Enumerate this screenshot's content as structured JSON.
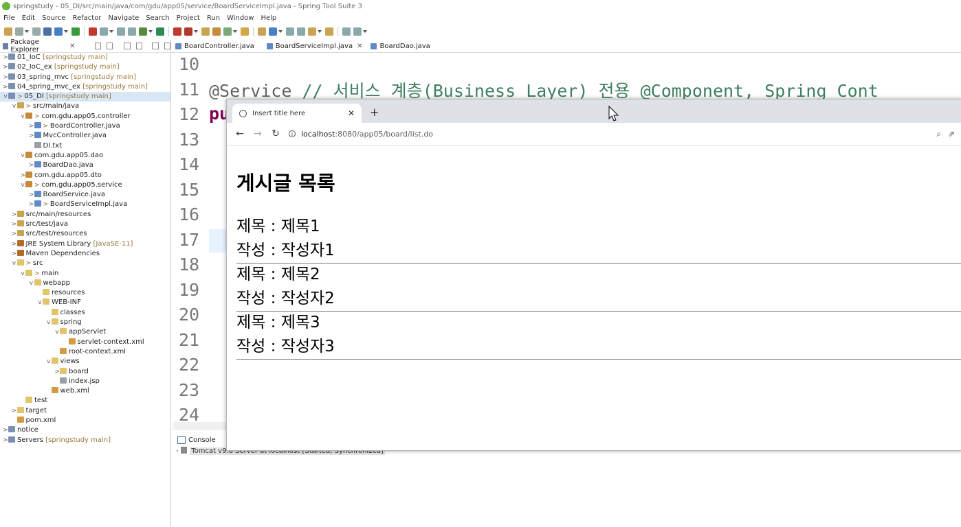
{
  "window": {
    "title": "springstudy - 05_DI/src/main/java/com/gdu/app05/service/BoardServiceImpl.java - Spring Tool Suite 3"
  },
  "menu": [
    "File",
    "Edit",
    "Source",
    "Refactor",
    "Navigate",
    "Search",
    "Project",
    "Run",
    "Window",
    "Help"
  ],
  "package_explorer": {
    "title": "Package Explorer",
    "items": [
      {
        "indent": 0,
        "twisty": ">",
        "icon": "project",
        "prefix": "",
        "label": "01_IoC",
        "suffix": " [springstudy main]"
      },
      {
        "indent": 0,
        "twisty": ">",
        "icon": "project",
        "prefix": "",
        "label": "02_IoC_ex",
        "suffix": " [springstudy main]"
      },
      {
        "indent": 0,
        "twisty": ">",
        "icon": "project",
        "prefix": "",
        "label": "03_spring_mvc",
        "suffix": " [springstudy main]"
      },
      {
        "indent": 0,
        "twisty": ">",
        "icon": "project",
        "prefix": "",
        "label": "04_spring_mvc_ex",
        "suffix": " [springstudy main]"
      },
      {
        "indent": 0,
        "twisty": "v",
        "icon": "project",
        "prefix": "> ",
        "label": "05_DI",
        "suffix": " [springstudy main]",
        "selected": true
      },
      {
        "indent": 1,
        "twisty": "v",
        "icon": "src",
        "prefix": "> ",
        "label": "src/main/java",
        "suffix": ""
      },
      {
        "indent": 2,
        "twisty": "v",
        "icon": "pkg",
        "prefix": "> ",
        "label": "com.gdu.app05.controller",
        "suffix": ""
      },
      {
        "indent": 3,
        "twisty": ">",
        "icon": "java",
        "prefix": "> ",
        "label": "BoardController.java",
        "suffix": ""
      },
      {
        "indent": 3,
        "twisty": ">",
        "icon": "java",
        "prefix": "",
        "label": "MvcController.java",
        "suffix": ""
      },
      {
        "indent": 3,
        "twisty": "",
        "icon": "txt",
        "prefix": "",
        "label": "DI.txt",
        "suffix": ""
      },
      {
        "indent": 2,
        "twisty": "v",
        "icon": "pkg",
        "prefix": "",
        "label": "com.gdu.app05.dao",
        "suffix": ""
      },
      {
        "indent": 3,
        "twisty": ">",
        "icon": "java",
        "prefix": "",
        "label": "BoardDao.java",
        "suffix": ""
      },
      {
        "indent": 2,
        "twisty": ">",
        "icon": "pkg",
        "prefix": "",
        "label": "com.gdu.app05.dto",
        "suffix": ""
      },
      {
        "indent": 2,
        "twisty": "v",
        "icon": "pkg",
        "prefix": "> ",
        "label": "com.gdu.app05.service",
        "suffix": ""
      },
      {
        "indent": 3,
        "twisty": ">",
        "icon": "java",
        "prefix": "",
        "label": "BoardService.java",
        "suffix": ""
      },
      {
        "indent": 3,
        "twisty": ">",
        "icon": "java",
        "prefix": "> ",
        "label": "BoardServiceImpl.java",
        "suffix": ""
      },
      {
        "indent": 1,
        "twisty": ">",
        "icon": "src",
        "prefix": "",
        "label": "src/main/resources",
        "suffix": ""
      },
      {
        "indent": 1,
        "twisty": ">",
        "icon": "src",
        "prefix": "",
        "label": "src/test/java",
        "suffix": ""
      },
      {
        "indent": 1,
        "twisty": ">",
        "icon": "src",
        "prefix": "",
        "label": "src/test/resources",
        "suffix": ""
      },
      {
        "indent": 1,
        "twisty": ">",
        "icon": "lib",
        "prefix": "",
        "label": "JRE System Library",
        "suffix": " [JavaSE-11]"
      },
      {
        "indent": 1,
        "twisty": ">",
        "icon": "lib",
        "prefix": "",
        "label": "Maven Dependencies",
        "suffix": ""
      },
      {
        "indent": 1,
        "twisty": "v",
        "icon": "folder",
        "prefix": "> ",
        "label": "src",
        "suffix": ""
      },
      {
        "indent": 2,
        "twisty": "v",
        "icon": "folder",
        "prefix": "> ",
        "label": "main",
        "suffix": ""
      },
      {
        "indent": 3,
        "twisty": "v",
        "icon": "folder",
        "prefix": "",
        "label": "webapp",
        "suffix": ""
      },
      {
        "indent": 4,
        "twisty": "",
        "icon": "folder",
        "prefix": "",
        "label": "resources",
        "suffix": ""
      },
      {
        "indent": 4,
        "twisty": "v",
        "icon": "folder",
        "prefix": "",
        "label": "WEB-INF",
        "suffix": ""
      },
      {
        "indent": 5,
        "twisty": "",
        "icon": "folder",
        "prefix": "",
        "label": "classes",
        "suffix": ""
      },
      {
        "indent": 5,
        "twisty": "v",
        "icon": "folder",
        "prefix": "",
        "label": "spring",
        "suffix": ""
      },
      {
        "indent": 6,
        "twisty": "v",
        "icon": "folder",
        "prefix": "",
        "label": "appServlet",
        "suffix": ""
      },
      {
        "indent": 7,
        "twisty": "",
        "icon": "xml",
        "prefix": "",
        "label": "servlet-context.xml",
        "suffix": ""
      },
      {
        "indent": 6,
        "twisty": "",
        "icon": "xml",
        "prefix": "",
        "label": "root-context.xml",
        "suffix": ""
      },
      {
        "indent": 5,
        "twisty": "v",
        "icon": "folder",
        "prefix": "",
        "label": "views",
        "suffix": ""
      },
      {
        "indent": 6,
        "twisty": ">",
        "icon": "folder",
        "prefix": "",
        "label": "board",
        "suffix": ""
      },
      {
        "indent": 6,
        "twisty": "",
        "icon": "txt",
        "prefix": "",
        "label": "index.jsp",
        "suffix": ""
      },
      {
        "indent": 5,
        "twisty": "",
        "icon": "xml",
        "prefix": "",
        "label": "web.xml",
        "suffix": ""
      },
      {
        "indent": 2,
        "twisty": "",
        "icon": "folder",
        "prefix": "",
        "label": "test",
        "suffix": ""
      },
      {
        "indent": 1,
        "twisty": ">",
        "icon": "folder",
        "prefix": "",
        "label": "target",
        "suffix": ""
      },
      {
        "indent": 1,
        "twisty": "",
        "icon": "xml",
        "prefix": "",
        "label": "pom.xml",
        "suffix": ""
      },
      {
        "indent": 0,
        "twisty": ">",
        "icon": "project",
        "prefix": "",
        "label": "notice",
        "suffix": ""
      },
      {
        "indent": 0,
        "twisty": ">",
        "icon": "project",
        "prefix": "",
        "label": "Servers",
        "suffix": " [springstudy main]"
      }
    ]
  },
  "editor_tabs": [
    {
      "label": "BoardController.java",
      "close": ""
    },
    {
      "label": "BoardServiceImpl.java",
      "close": "✕",
      "active": true
    },
    {
      "label": "BoardDao.java",
      "close": ""
    }
  ],
  "editor": {
    "line_numbers": [
      "10",
      "11",
      "12",
      "13",
      "14",
      "15",
      "16",
      "17",
      "18",
      "19",
      "20",
      "21",
      "22",
      "23",
      "24"
    ],
    "line11_annotation": "@Service",
    "line11_comment": "  // 서비스 계층(Business Layer) 전용 @Component, Spring Cont",
    "line12_keyword": "pu"
  },
  "console": {
    "tab_label": "Console",
    "server_row": "Tomcat v9.0 Server at localhost  [Started, Synchronized]"
  },
  "browser": {
    "tab_title": "Insert title here",
    "tab_close": "✕",
    "new_tab": "+",
    "back": "←",
    "forward": "→",
    "reload": "↻",
    "info_glyph": "i",
    "url_host": "localhost",
    "url_path": ":8080/app05/board/list.do",
    "zoom": "⌕",
    "share": "⇗",
    "page": {
      "heading": "게시글 목록",
      "posts": [
        {
          "title_line": "제목 : 제목1",
          "writer_line": "작성 : 작성자1"
        },
        {
          "title_line": "제목 : 제목2",
          "writer_line": "작성 : 작성자2"
        },
        {
          "title_line": "제목 : 제목3",
          "writer_line": "작성 : 작성자3"
        }
      ]
    }
  },
  "colors": {
    "comment": "#3f7f5f",
    "annotation": "#646464",
    "keyword": "#7f0055",
    "selection": "#d8e6f5"
  }
}
